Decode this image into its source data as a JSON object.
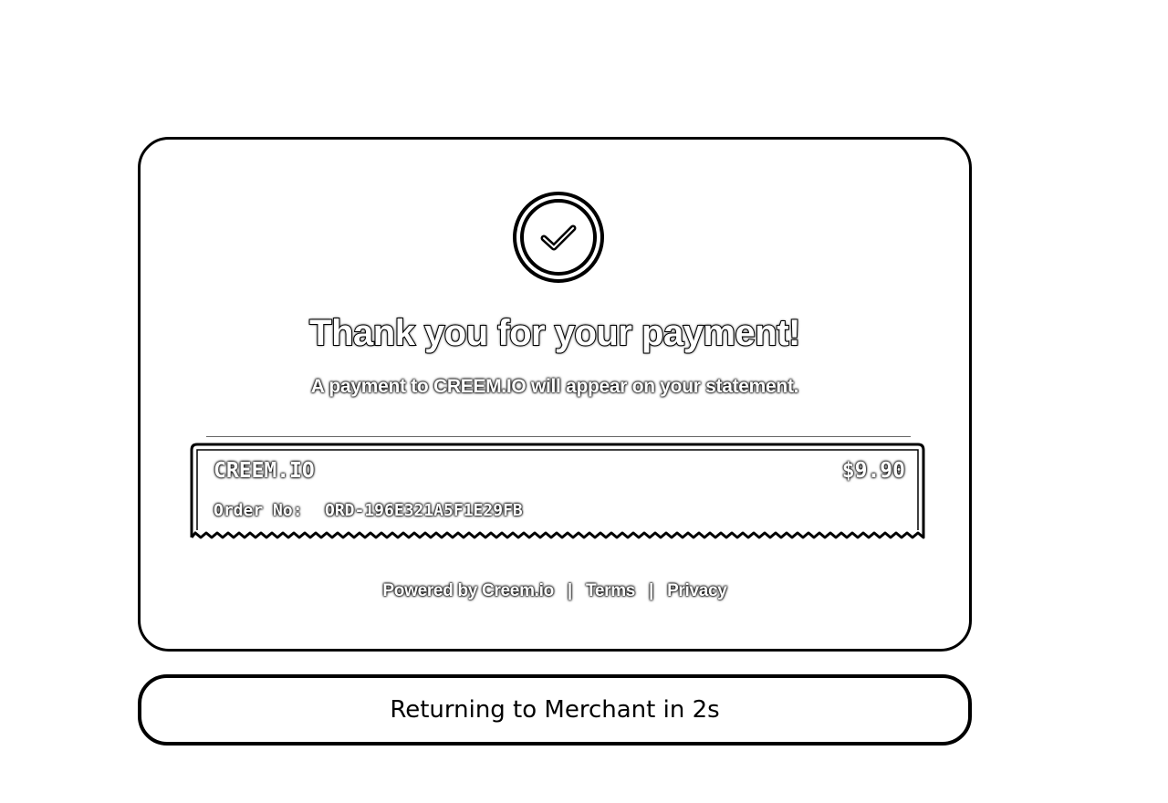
{
  "confirmation": {
    "title": "Thank you for your payment!",
    "subtitle": "A payment to CREEM.IO will appear on your statement."
  },
  "receipt": {
    "merchant": "CREEM.IO",
    "amount": "$9.90",
    "order_label": "Order No:",
    "order_number": "ORD-196E321A5F1E29FB"
  },
  "footer": {
    "powered_by": "Powered by Creem.io",
    "separator": "|",
    "terms": "Terms",
    "privacy": "Privacy"
  },
  "redirect": {
    "message": "Returning to Merchant in 2s"
  },
  "icons": {
    "success": "check-circle-icon"
  }
}
